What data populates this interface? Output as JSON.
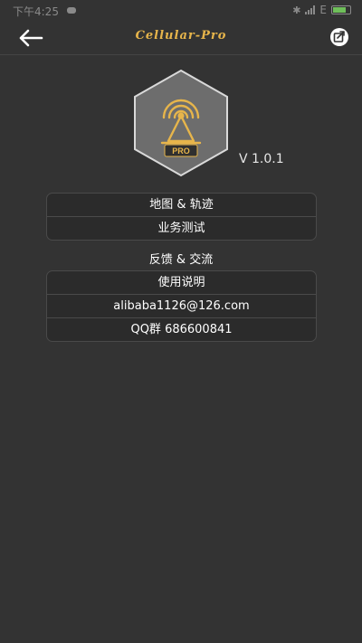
{
  "status_bar": {
    "time": "下午4:25",
    "network": "E"
  },
  "toolbar": {
    "title": "Cellular-Pro",
    "back_icon": "arrow-left-icon",
    "share_icon": "share-icon"
  },
  "logo": {
    "badge_text": "PRO",
    "accent_color": "#e7b54b"
  },
  "version": "V 1.0.1",
  "menu_group_1": [
    {
      "label": "地图 & 轨迹"
    },
    {
      "label": "业务测试"
    }
  ],
  "section_label": "反馈 & 交流",
  "menu_group_2": [
    {
      "label": "使用说明"
    },
    {
      "label": "alibaba1126@126.com"
    },
    {
      "label": "QQ群 686600841"
    }
  ]
}
